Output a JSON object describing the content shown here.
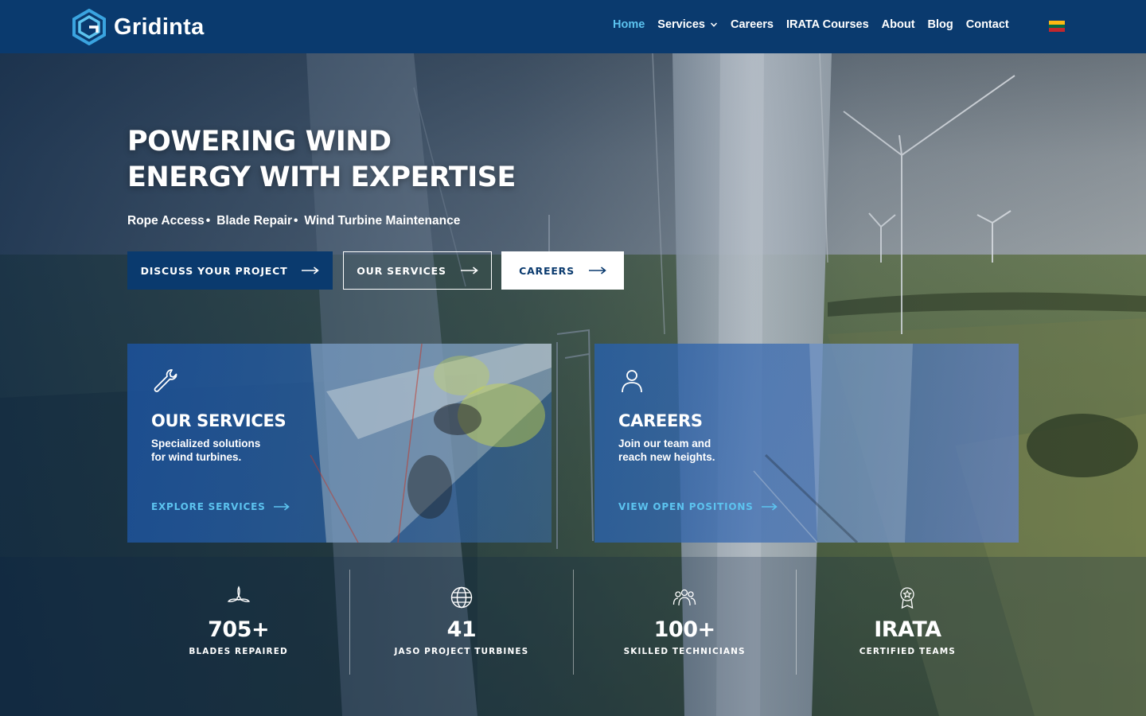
{
  "brand": {
    "name": "Gridinta",
    "logo_icon": "gridinta-logo-icon"
  },
  "colors": {
    "navy": "#0a3a6e",
    "accent": "#5cc3ef",
    "white": "#ffffff"
  },
  "nav": {
    "items": [
      {
        "label": "Home",
        "active": true
      },
      {
        "label": "Services",
        "has_dropdown": true
      },
      {
        "label": "Careers"
      },
      {
        "label": "IRATA Courses"
      },
      {
        "label": "About"
      },
      {
        "label": "Blog"
      },
      {
        "label": "Contact"
      }
    ],
    "language_flag": "lithuania-flag-icon"
  },
  "hero": {
    "title_line1": "POWERING WIND",
    "title_line2": "ENERGY WITH EXPERTISE",
    "subtitle": [
      "Rope Access",
      "Blade Repair",
      "Wind Turbine Maintenance"
    ],
    "separator": "•",
    "buttons": {
      "discuss": "DISCUSS YOUR PROJECT",
      "services": "OUR SERVICES",
      "careers": "CAREERS"
    }
  },
  "cards": {
    "services": {
      "icon": "wrench-icon",
      "title": "OUR SERVICES",
      "text_line1": "Specialized solutions",
      "text_line2": "for wind turbines.",
      "link": "EXPLORE SERVICES"
    },
    "careers": {
      "icon": "person-icon",
      "title": "CAREERS",
      "text_line1": "Join our team and",
      "text_line2": "reach new heights.",
      "link": "VIEW OPEN POSITIONS"
    }
  },
  "stats": [
    {
      "icon": "turbine-icon",
      "value": "705+",
      "label": "BLADES REPAIRED"
    },
    {
      "icon": "globe-icon",
      "value": "41",
      "label": "JASO PROJECT TURBINES"
    },
    {
      "icon": "team-icon",
      "value": "100+",
      "label": "SKILLED TECHNICIANS"
    },
    {
      "icon": "certificate-icon",
      "value": "IRATA",
      "label": "CERTIFIED TEAMS"
    }
  ]
}
